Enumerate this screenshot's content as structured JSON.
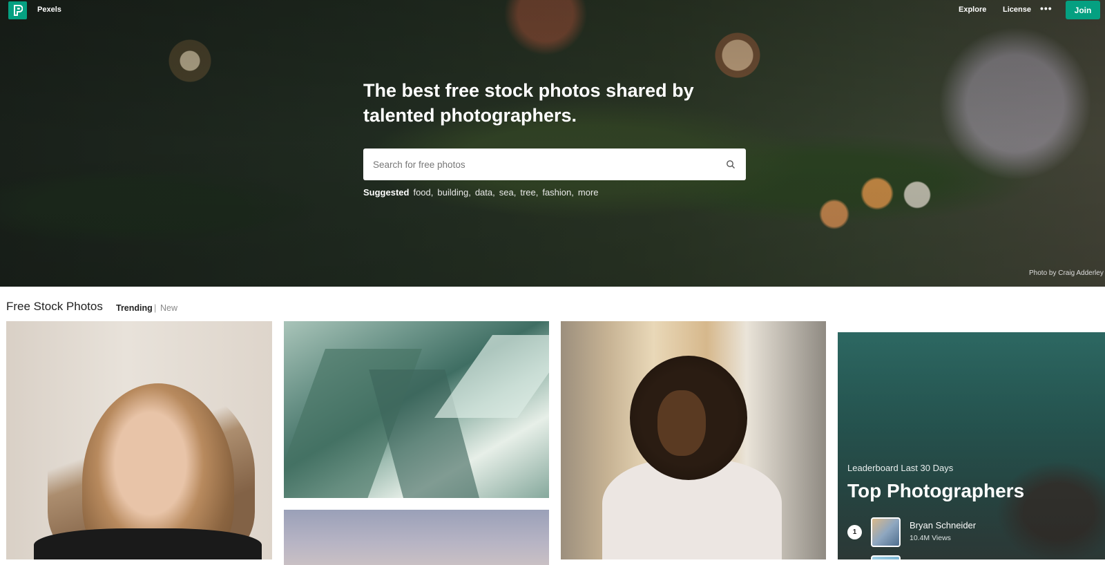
{
  "nav": {
    "brand": "Pexels",
    "links": [
      "Explore",
      "License"
    ],
    "more": "•••",
    "join": "Join",
    "brand_color": "#05a081"
  },
  "hero": {
    "title": "The best free stock photos shared by talented photographers.",
    "search_placeholder": "Search for free photos",
    "suggested_label": "Suggested",
    "suggested": [
      "food,",
      "building,",
      "data,",
      "sea,",
      "tree,",
      "fashion,",
      "more"
    ],
    "photo_credit": "Photo by Craig Adderley"
  },
  "section": {
    "title": "Free Stock Photos",
    "tab_trending": "Trending",
    "separator": "|",
    "tab_new": "New"
  },
  "leaderboard": {
    "subtitle": "Leaderboard Last 30 Days",
    "title": "Top Photographers",
    "entries": [
      {
        "rank": "1",
        "name": "Bryan Schneider",
        "views": "10.4M Views"
      }
    ]
  }
}
